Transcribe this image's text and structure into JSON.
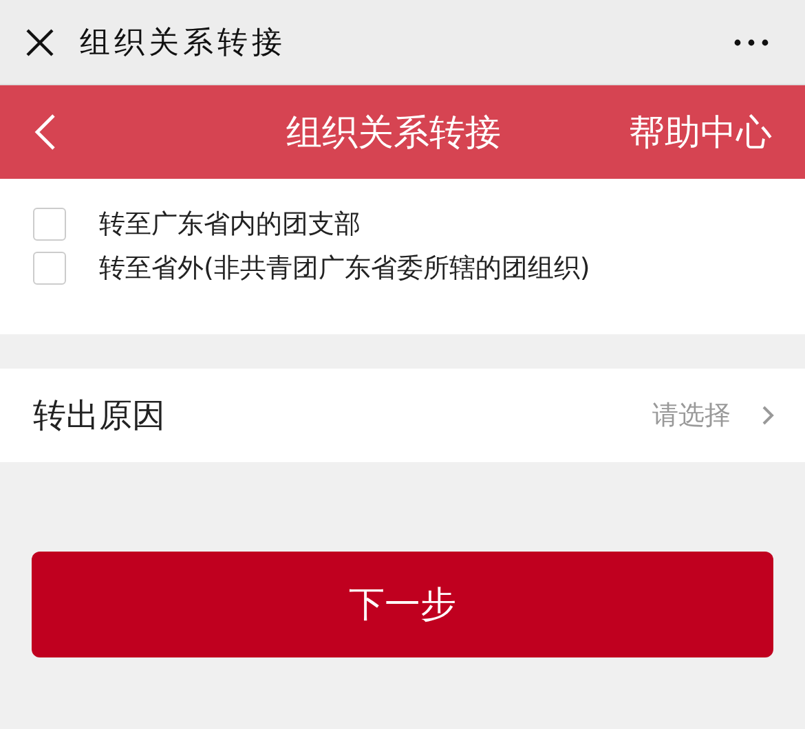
{
  "window": {
    "title": "组织关系转接"
  },
  "header": {
    "title": "组织关系转接",
    "help": "帮助中心"
  },
  "options": [
    {
      "label": "转至广东省内的团支部",
      "checked": false
    },
    {
      "label": "转至省外(非共青团广东省委所辖的团组织)",
      "checked": false
    }
  ],
  "reason": {
    "label": "转出原因",
    "placeholder": "请选择"
  },
  "next_button": "下一步"
}
